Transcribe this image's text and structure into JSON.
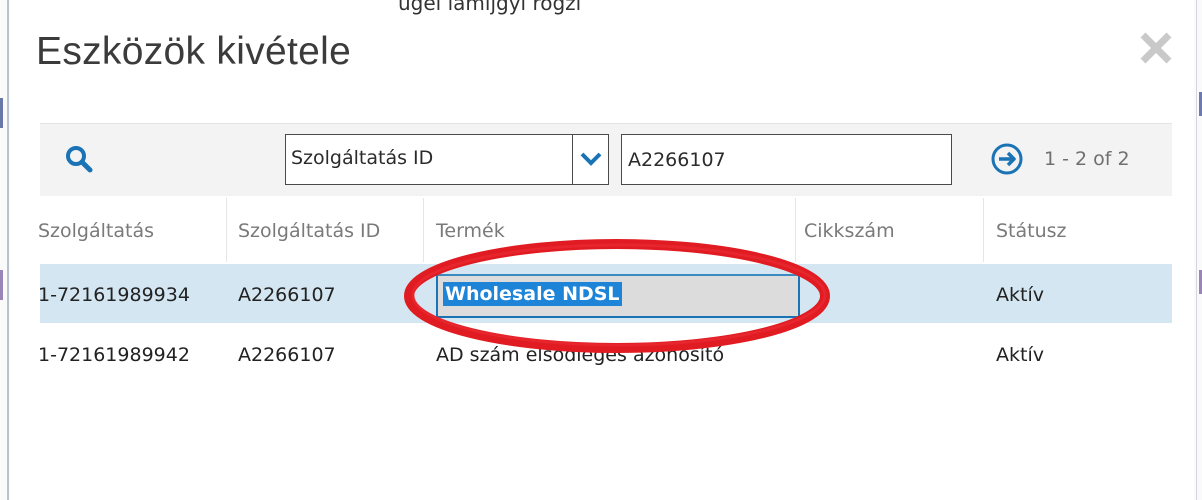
{
  "top_fragment": "ügel lámijgyi rögzí",
  "dialog": {
    "title": "Eszközök kivétele"
  },
  "toolbar": {
    "field_select_value": "Szolgáltatás ID",
    "filter_value": "A2266107",
    "pager_text": "1 - 2 of 2"
  },
  "table": {
    "headers": [
      "Szolgáltatás",
      "Szolgáltatás ID",
      "Termék",
      "Cikkszám",
      "Státusz"
    ],
    "rows": [
      {
        "szolgaltatas": "1-72161989934",
        "szolgaltatas_id": "A2266107",
        "termek": "Wholesale NDSL",
        "cikkszam": "",
        "statusz": "Aktív"
      },
      {
        "szolgaltatas": "1-72161989942",
        "szolgaltatas_id": "A2266107",
        "termek": "AD szám elsődleges azonosító",
        "cikkszam": "",
        "statusz": "Aktív"
      }
    ]
  },
  "icons": {
    "search": "search-icon",
    "close": "close-icon",
    "dropdown": "chevron-down-icon",
    "go": "arrow-right-circle-icon"
  },
  "colors": {
    "accent": "#1a73b5",
    "selected_row": "#d3e6f1",
    "annotation_red": "#e01b22",
    "selection_highlight": "#1d84d8"
  }
}
